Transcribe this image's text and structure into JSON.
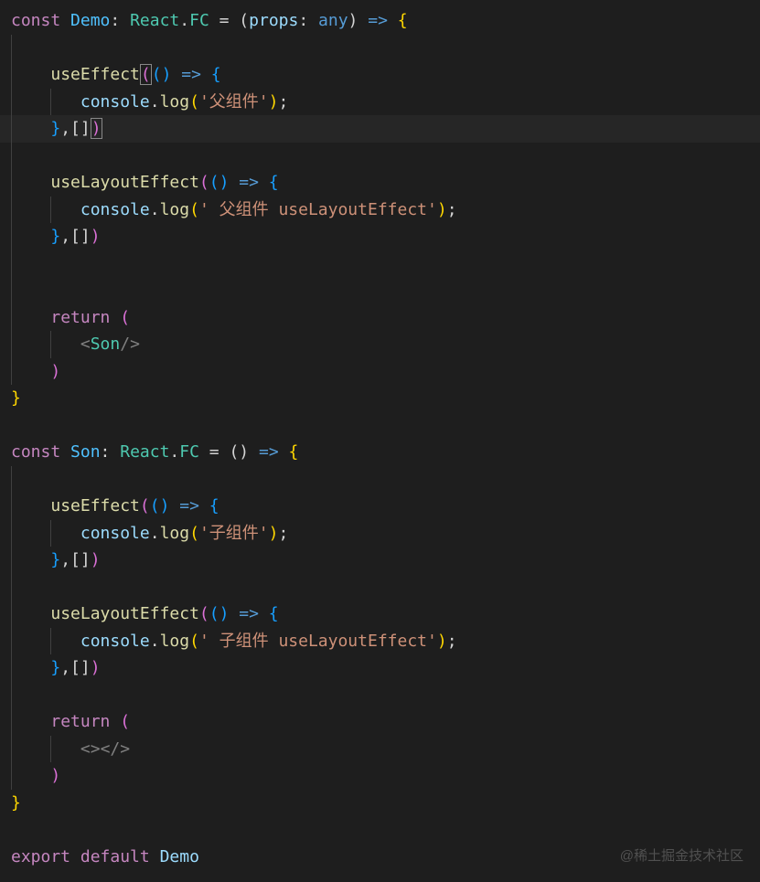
{
  "code": {
    "t1": "const",
    "t2": "Demo",
    "t3": ": ",
    "t4": "React",
    "t5": ".",
    "t6": "FC",
    "t7": " = (",
    "t8": "props",
    "t9": ": ",
    "t10": "any",
    "t11": ") ",
    "t12": "=>",
    "t13": " {",
    "t_useEffect": "useEffect",
    "t_paren_open": "(",
    "t_paren_close": ")",
    "t_arrow_body": "() ",
    "t_arrow": "=>",
    "t_brace_open": " {",
    "t_console": "console",
    "t_dot": ".",
    "t_log": "log",
    "t_str_parent": "'父组件'",
    "t_str_parent_layout": "' 父组件 useLayoutEffect'",
    "t_str_child": "'子组件'",
    "t_str_child_layout": "' 子组件 useLayoutEffect'",
    "t_semicolon": ";",
    "t_brace_close": "}",
    "t_deps": ",[]",
    "t_useLayoutEffect": "useLayoutEffect",
    "t_return": "return",
    "t_return_paren": " (",
    "t_Son": "Son",
    "t_tag_lt": "<",
    "t_tag_close": "/>",
    "t_tag_gt": ">",
    "t_frag_open": "<>",
    "t_frag_close": "</>",
    "t_const2": "const",
    "t_SonVar": "Son",
    "t_eq_arrow_empty": " = () ",
    "t_export": "export",
    "t_default": "default",
    "t_Demo_ref": "Demo"
  },
  "watermark": "@稀土掘金技术社区"
}
